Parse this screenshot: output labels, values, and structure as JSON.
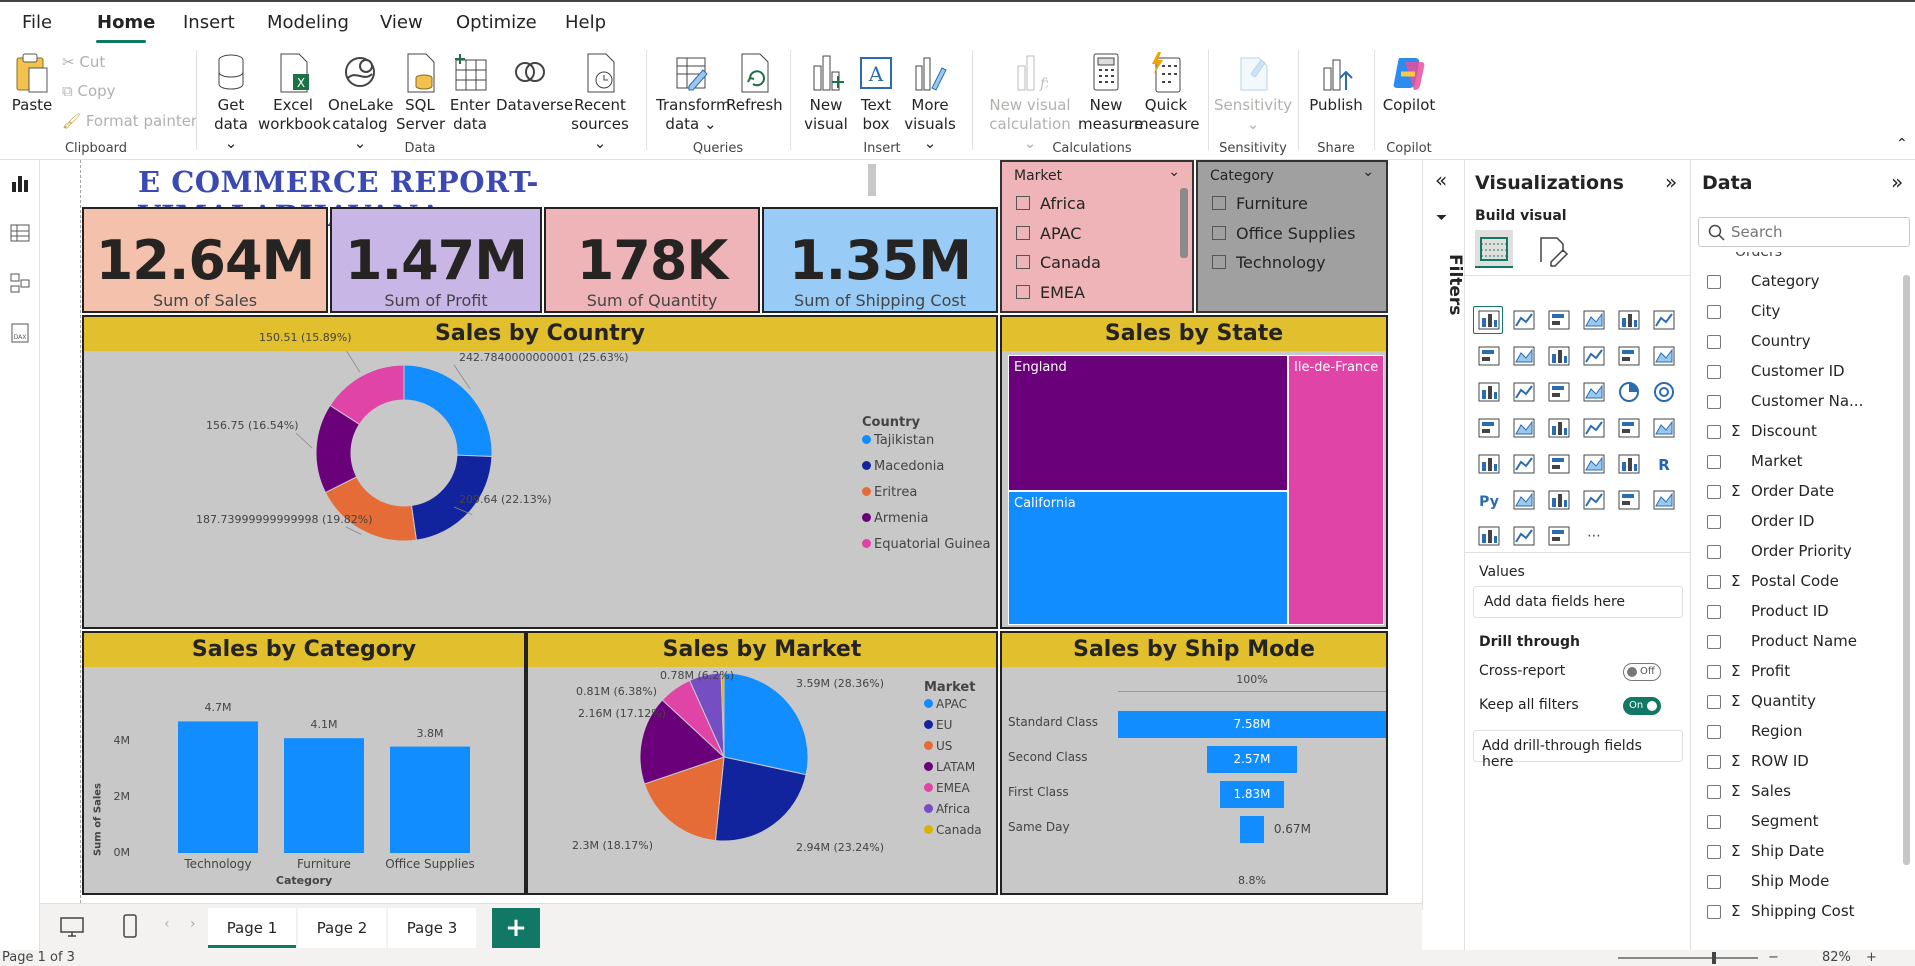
{
  "menu": [
    "File",
    "Home",
    "Insert",
    "Modeling",
    "View",
    "Optimize",
    "Help"
  ],
  "ribbon": {
    "clipboard": {
      "paste": "Paste",
      "cut": "Cut",
      "copy": "Copy",
      "format_painter": "Format painter",
      "group": "Clipboard"
    },
    "data": {
      "get_data": "Get",
      "get_data2": "data",
      "excel": "Excel",
      "excel2": "workbook",
      "onelake": "OneLake",
      "onelake2": "catalog",
      "sql": "SQL",
      "sql2": "Server",
      "enter": "Enter",
      "enter2": "data",
      "dataverse": "Dataverse",
      "recent": "Recent",
      "recent2": "sources",
      "group": "Data"
    },
    "queries": {
      "transform": "Transform",
      "transform2": "data",
      "refresh": "Refresh",
      "group": "Queries"
    },
    "insert": {
      "new_visual": "New",
      "new_visual2": "visual",
      "text_box": "Text",
      "text_box2": "box",
      "more_visuals": "More",
      "more_visuals2": "visuals",
      "group": "Insert"
    },
    "calculations": {
      "nvc": "New visual",
      "nvc2": "calculation",
      "new_measure": "New",
      "new_measure2": "measure",
      "quick": "Quick",
      "quick2": "measure",
      "group": "Calculations"
    },
    "sensitivity": {
      "label": "Sensitivity",
      "group": "Sensitivity"
    },
    "share": {
      "publish": "Publish",
      "group": "Share"
    },
    "copilot": {
      "label": "Copilot",
      "group": "Copilot"
    }
  },
  "report": {
    "title": "E COMMERCE REPORT-VIMALABHAVANA",
    "cards": [
      {
        "value": "12.64M",
        "label": "Sum of Sales",
        "color": "#f4c2ac"
      },
      {
        "value": "1.47M",
        "label": "Sum of Profit",
        "color": "#c8b6e6"
      },
      {
        "value": "178K",
        "label": "Sum of Quantity",
        "color": "#efb4b7"
      },
      {
        "value": "1.35M",
        "label": "Sum of Shipping Cost",
        "color": "#98ccf6"
      }
    ],
    "market_slicer": {
      "title": "Market",
      "items": [
        "Africa",
        "APAC",
        "Canada",
        "EMEA"
      ]
    },
    "category_slicer": {
      "title": "Category",
      "items": [
        "Furniture",
        "Office Supplies",
        "Technology"
      ]
    }
  },
  "chart_data": [
    {
      "type": "pie",
      "title": "Sales by Country",
      "legend_title": "Country",
      "categories": [
        "Tajikistan",
        "Macedonia",
        "Eritrea",
        "Armenia",
        "Equatorial Guinea"
      ],
      "values": [
        242.78,
        209.64,
        187.74,
        156.75,
        150.51
      ],
      "data_labels": [
        "242.7840000000001 (25.63%)",
        "209.64 (22.13%)",
        "187.73999999999998 (19.82%)",
        "156.75 (16.54%)",
        "150.51 (15.89%)"
      ],
      "colors": [
        "#118dff",
        "#12239e",
        "#e66c37",
        "#6b007b",
        "#e044a7"
      ],
      "donut": true,
      "legend_position": "right"
    },
    {
      "type": "heatmap",
      "subtype": "treemap",
      "title": "Sales by State",
      "categories": [
        "England",
        "California",
        "Ile-de-France"
      ],
      "colors": [
        "#6b007b",
        "#118dff",
        "#e044a7"
      ]
    },
    {
      "type": "bar",
      "title": "Sales by Category",
      "categories": [
        "Technology",
        "Furniture",
        "Office Supplies"
      ],
      "values": [
        4.7,
        4.1,
        3.8
      ],
      "data_labels": [
        "4.7M",
        "4.1M",
        "3.8M"
      ],
      "xlabel": "Category",
      "ylabel": "Sum of Sales",
      "yticks": [
        "0M",
        "2M",
        "4M"
      ],
      "ylim": [
        0,
        5
      ],
      "color": "#118dff"
    },
    {
      "type": "pie",
      "title": "Sales by Market",
      "legend_title": "Market",
      "categories": [
        "APAC",
        "EU",
        "US",
        "LATAM",
        "EMEA",
        "Africa",
        "Canada"
      ],
      "values": [
        3.59,
        2.94,
        2.3,
        2.16,
        0.81,
        0.78,
        0.07
      ],
      "data_labels": [
        "3.59M (28.36%)",
        "2.94M (23.24%)",
        "2.3M (18.17%)",
        "2.16M (17.12%)",
        "0.81M (6.38%)",
        "0.78M (6.2%)",
        ""
      ],
      "colors": [
        "#118dff",
        "#12239e",
        "#e66c37",
        "#6b007b",
        "#e044a7",
        "#744ec2",
        "#d9b300"
      ],
      "legend_position": "right"
    },
    {
      "type": "bar",
      "subtype": "funnel",
      "title": "Sales by Ship Mode",
      "categories": [
        "Standard Class",
        "Second Class",
        "First Class",
        "Same Day"
      ],
      "values": [
        7.58,
        2.57,
        1.83,
        0.67
      ],
      "data_labels": [
        "7.58M",
        "2.57M",
        "1.83M",
        "0.67M"
      ],
      "top_label": "100%",
      "bottom_label": "8.8%",
      "color": "#118dff"
    }
  ],
  "filters_label": "Filters",
  "visualizations": {
    "title": "Visualizations",
    "build": "Build visual",
    "values": "Values",
    "add_fields": "Add data fields here",
    "drill": "Drill through",
    "cross": "Cross-report",
    "cross_state": "Off",
    "keep": "Keep all filters",
    "keep_state": "On",
    "add_drill": "Add drill-through fields here"
  },
  "data_pane": {
    "title": "Data",
    "search_placeholder": "Search",
    "table": "Orders",
    "fields": [
      {
        "name": "Category",
        "sigma": ""
      },
      {
        "name": "City",
        "sigma": ""
      },
      {
        "name": "Country",
        "sigma": ""
      },
      {
        "name": "Customer ID",
        "sigma": ""
      },
      {
        "name": "Customer Na...",
        "sigma": ""
      },
      {
        "name": "Discount",
        "sigma": "Σ"
      },
      {
        "name": "Market",
        "sigma": ""
      },
      {
        "name": "Order Date",
        "sigma": "Σ"
      },
      {
        "name": "Order ID",
        "sigma": ""
      },
      {
        "name": "Order Priority",
        "sigma": ""
      },
      {
        "name": "Postal Code",
        "sigma": "Σ"
      },
      {
        "name": "Product ID",
        "sigma": ""
      },
      {
        "name": "Product Name",
        "sigma": ""
      },
      {
        "name": "Profit",
        "sigma": "Σ"
      },
      {
        "name": "Quantity",
        "sigma": "Σ"
      },
      {
        "name": "Region",
        "sigma": ""
      },
      {
        "name": "ROW ID",
        "sigma": "Σ"
      },
      {
        "name": "Sales",
        "sigma": "Σ"
      },
      {
        "name": "Segment",
        "sigma": ""
      },
      {
        "name": "Ship Date",
        "sigma": "Σ"
      },
      {
        "name": "Ship Mode",
        "sigma": ""
      },
      {
        "name": "Shipping Cost",
        "sigma": "Σ"
      }
    ]
  },
  "pages": [
    "Page 1",
    "Page 2",
    "Page 3"
  ],
  "add_page": "+",
  "status": {
    "page": "Page 1 of 3",
    "zoom": "82%"
  }
}
